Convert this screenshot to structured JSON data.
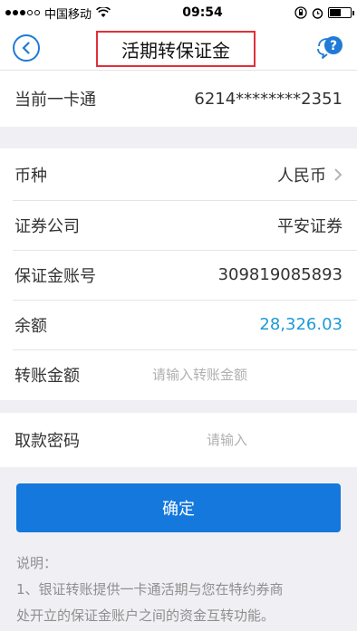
{
  "status_bar": {
    "carrier": "中国移动",
    "time": "09:54"
  },
  "nav": {
    "title": "活期转保证金"
  },
  "card_row": {
    "label": "当前一卡通",
    "value": "6214********2351"
  },
  "form": {
    "currency_label": "币种",
    "currency_value": "人民币",
    "broker_label": "证券公司",
    "broker_value": "平安证券",
    "account_label": "保证金账号",
    "account_value": "309819085893",
    "balance_label": "余额",
    "balance_value": "28,326.03",
    "amount_label": "转账金额",
    "amount_placeholder": "请输入转账金额",
    "password_label": "取款密码",
    "password_placeholder": "请输入"
  },
  "confirm_label": "确定",
  "notes": {
    "title": "说明：",
    "line1": "1、银证转账提供一卡通活期与您在特约券商",
    "line2": "处开立的保证金账户之间的资金互转功能。"
  },
  "colors": {
    "accent": "#1478dc",
    "balance": "#1e9ad6",
    "highlight_border": "#e0303a"
  }
}
